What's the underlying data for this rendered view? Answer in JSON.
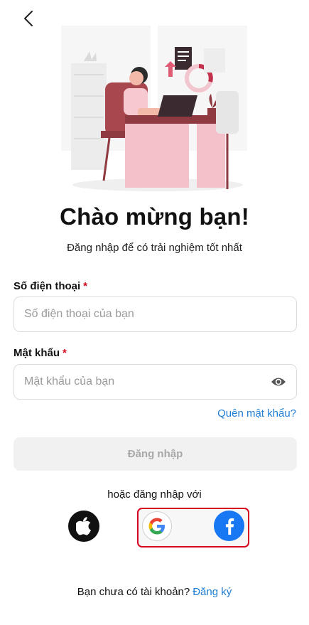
{
  "header": {
    "back_icon": "chevron-left-icon"
  },
  "welcome": {
    "title": "Chào mừng bạn!",
    "subtitle": "Đăng nhập để có trải nghiệm tốt nhất"
  },
  "phone": {
    "label": "Số điện thoại",
    "required_mark": "*",
    "placeholder": "Số điện thoại của bạn",
    "value": ""
  },
  "password": {
    "label": "Mật khẩu",
    "required_mark": "*",
    "placeholder": "Mật khẩu của bạn",
    "value": "",
    "toggle_icon": "eye-icon"
  },
  "forgot_password": "Quên mật khẩu?",
  "login_button": "Đăng nhập",
  "social": {
    "label": "hoặc đăng nhập với",
    "providers": [
      "apple-icon",
      "google-icon",
      "facebook-icon"
    ],
    "highlight_color": "#d8001f"
  },
  "signup": {
    "prompt": "Bạn chưa có tài khoản?",
    "link": "Đăng ký"
  },
  "colors": {
    "link": "#1e7ed6",
    "required": "#d0011b",
    "facebook": "#1877f2",
    "button_disabled_bg": "#f1f1f1"
  }
}
